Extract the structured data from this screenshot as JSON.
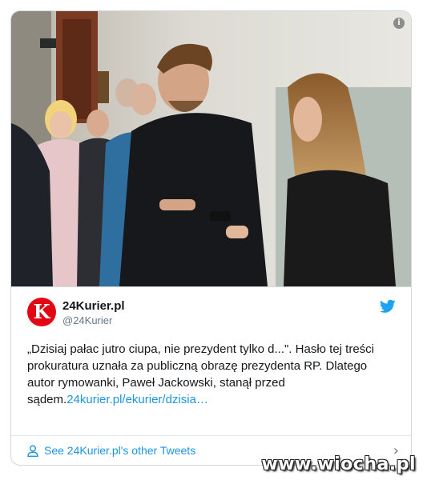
{
  "photo": {
    "alt": "news photo",
    "info_icon_glyph": "i"
  },
  "author": {
    "avatar_letter": "K",
    "avatar_color": "#e30613",
    "display_name": "24Kurier.pl",
    "handle": "@24Kurier"
  },
  "tweet": {
    "text": "„Dzisiaj pałac jutro ciupa, nie prezydent tylko d...\". Hasło tej treści prokuratura uznała za publiczną obrazę prezydenta RP. Dlatego autor rymowanki, Paweł Jackowski, stanął przed sądem.",
    "link": "24kurier.pl/ekurier/dzisia…"
  },
  "footer": {
    "label": "See 24Kurier.pl's other Tweets",
    "chevron": "›"
  },
  "colors": {
    "link": "#1b95e0",
    "twitter_blue": "#1da1f2",
    "border": "#cfd9de"
  },
  "icons": [
    "info-icon",
    "twitter-bird-icon",
    "person-icon",
    "chevron-right-icon"
  ],
  "watermark": "www.wiocha.pl"
}
